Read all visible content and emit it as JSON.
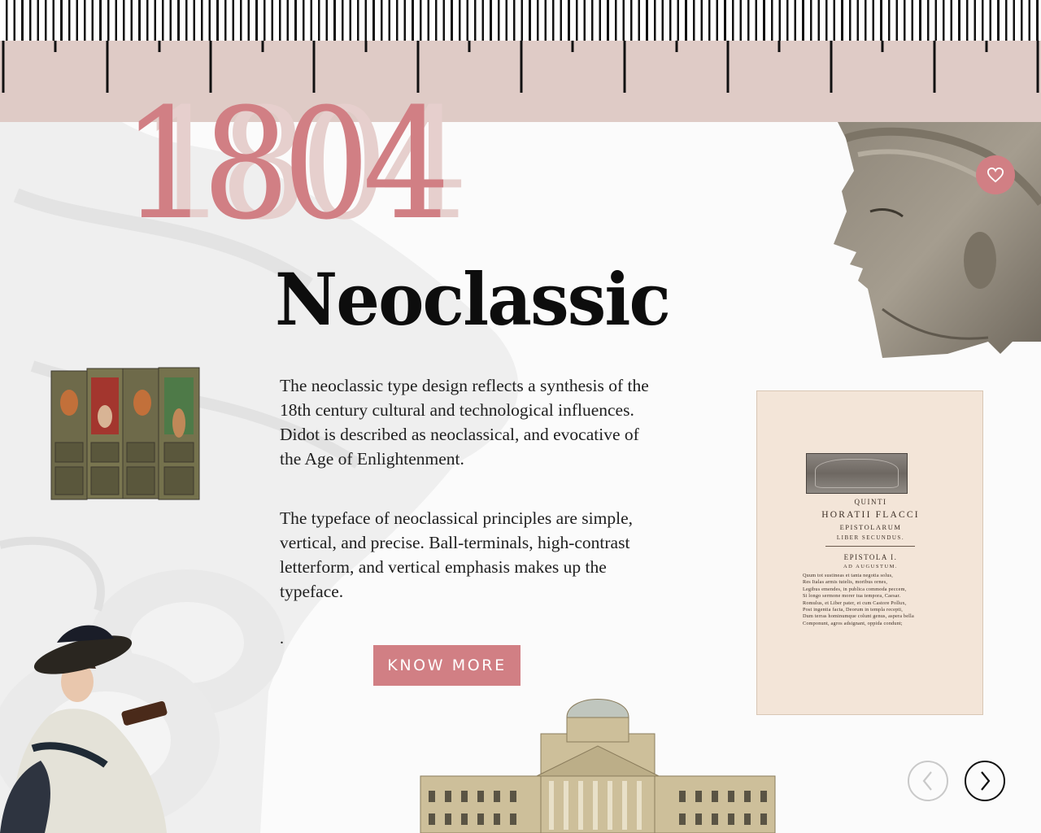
{
  "header": {
    "year": "1804",
    "title": "Neoclassic"
  },
  "main": {
    "paragraphs": [
      "The neoclassic type design reflects a synthesis of the 18th century cultural and technological influences. Didot is described as neoclassical, and evocative of the Age of Enlightenment.",
      "The typeface of neoclassical principles are simple, vertical, and precise. Ball-terminals, high-contrast letterform, and vertical emphasis makes up the typeface."
    ],
    "dot": ".",
    "cta_label": "KNOW MORE"
  },
  "book_page": {
    "line1": "QUINTI",
    "line2": "HORATII FLACCI",
    "line3": "EPISTOLARUM",
    "line4": "LIBER SECUNDUS.",
    "line5": "EPISTOLA I.",
    "line6": "AD AUGUSTUM.",
    "verses": [
      "Quum tot sustineas et tanta negotia solus,",
      "Res Italas armis tutelis, moribus ornes,",
      "Legibus emendes, in publica commoda peccem,",
      "Si longo sermone morer tua tempora, Caesar.",
      "Romulus, et Liber pater, et cum Castore Pollux,",
      "Post ingentia facta, Deorum in templa recepti,",
      "Dum terras hominumque colunt genus, aspera bella",
      "Componunt, agros adsignant, oppida condunt;"
    ]
  },
  "icons": {
    "favorite": "heart-icon",
    "prev": "chevron-left-icon",
    "next": "chevron-right-icon"
  },
  "colors": {
    "accent": "#d17f84",
    "ruler_band": "#dfcbc6",
    "year_shadow": "#e6cfcd",
    "text": "#0d0d0d"
  }
}
